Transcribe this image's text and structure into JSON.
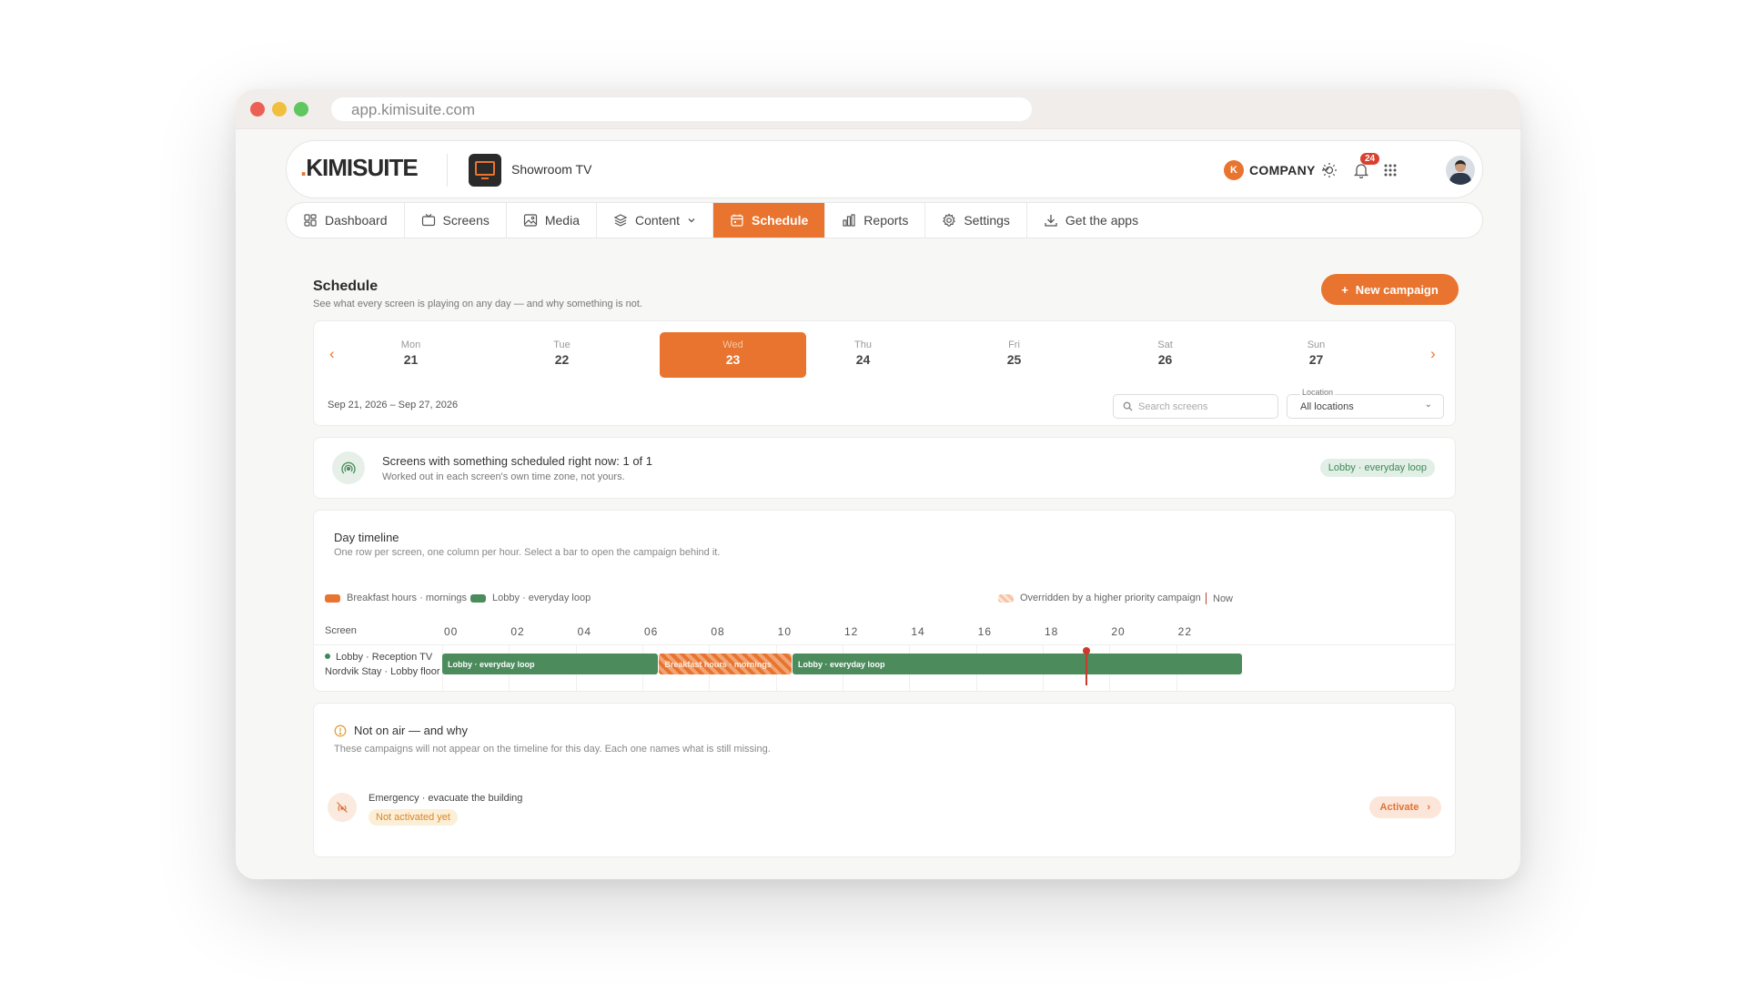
{
  "browser": {
    "url": "app.kimisuite.com"
  },
  "brand": {
    "logo_text": "KIMISUITE",
    "accent": "#e8742f"
  },
  "device": {
    "name": "Showroom TV"
  },
  "company": {
    "initial": "K",
    "name": "COMPANY"
  },
  "notifications": {
    "count": "24"
  },
  "nav": {
    "items": [
      {
        "label": "Dashboard",
        "icon": "dashboard-grid-icon"
      },
      {
        "label": "Screens",
        "icon": "tv-icon"
      },
      {
        "label": "Media",
        "icon": "image-icon"
      },
      {
        "label": "Content",
        "icon": "layers-icon"
      },
      {
        "label": "Schedule",
        "icon": "calendar-icon",
        "active": true
      },
      {
        "label": "Reports",
        "icon": "bar-chart-icon"
      },
      {
        "label": "Settings",
        "icon": "gear-icon"
      },
      {
        "label": "Get the apps",
        "icon": "download-icon"
      }
    ]
  },
  "page": {
    "title": "Schedule",
    "subtitle": "See what every screen is playing on any day — and why something is not.",
    "new_campaign": "New campaign"
  },
  "week": {
    "days": [
      {
        "name": "Mon",
        "date": "21"
      },
      {
        "name": "Tue",
        "date": "22"
      },
      {
        "name": "Wed",
        "date": "23",
        "selected": true
      },
      {
        "name": "Thu",
        "date": "24"
      },
      {
        "name": "Fri",
        "date": "25"
      },
      {
        "name": "Sat",
        "date": "26"
      },
      {
        "name": "Sun",
        "date": "27"
      }
    ],
    "range": "Sep 21, 2026 – Sep 27, 2026",
    "search_placeholder": "Search screens",
    "location_label": "Location",
    "location_value": "All locations"
  },
  "now_status": {
    "title": "Screens with something scheduled right now: 1 of 1",
    "subtitle": "Worked out in each screen's own time zone, not yours.",
    "chip": "Lobby · everyday loop"
  },
  "timeline": {
    "title": "Day timeline",
    "subtitle": "One row per screen, one column per hour. Select a bar to open the campaign behind it.",
    "legend": {
      "breakfast": "Breakfast hours · mornings",
      "lobby": "Lobby · everyday loop",
      "overridden": "Overridden by a higher priority campaign",
      "now": "Now"
    },
    "screen_header": "Screen",
    "hours": [
      "00",
      "02",
      "04",
      "06",
      "08",
      "10",
      "12",
      "14",
      "16",
      "18",
      "20",
      "22"
    ],
    "rows": [
      {
        "name": "Lobby · Reception TV",
        "location": "Nordvik Stay · Lobby floor",
        "bars": [
          {
            "label": "Lobby · everyday loop",
            "start": 0,
            "end": 6.5,
            "kind": "active"
          },
          {
            "label": "Breakfast hours · mornings",
            "start": 6.5,
            "end": 10.5,
            "kind": "overridden"
          },
          {
            "label": "Lobby · everyday loop",
            "start": 10.5,
            "end": 24,
            "kind": "active"
          }
        ]
      }
    ],
    "now_hour": 19.3
  },
  "not_on_air": {
    "title": "Not on air — and why",
    "subtitle": "These campaigns will not appear on the timeline for this day. Each one names what is still missing.",
    "items": [
      {
        "name": "Emergency · evacuate the building",
        "status": "Not activated yet",
        "action": "Activate"
      }
    ]
  }
}
